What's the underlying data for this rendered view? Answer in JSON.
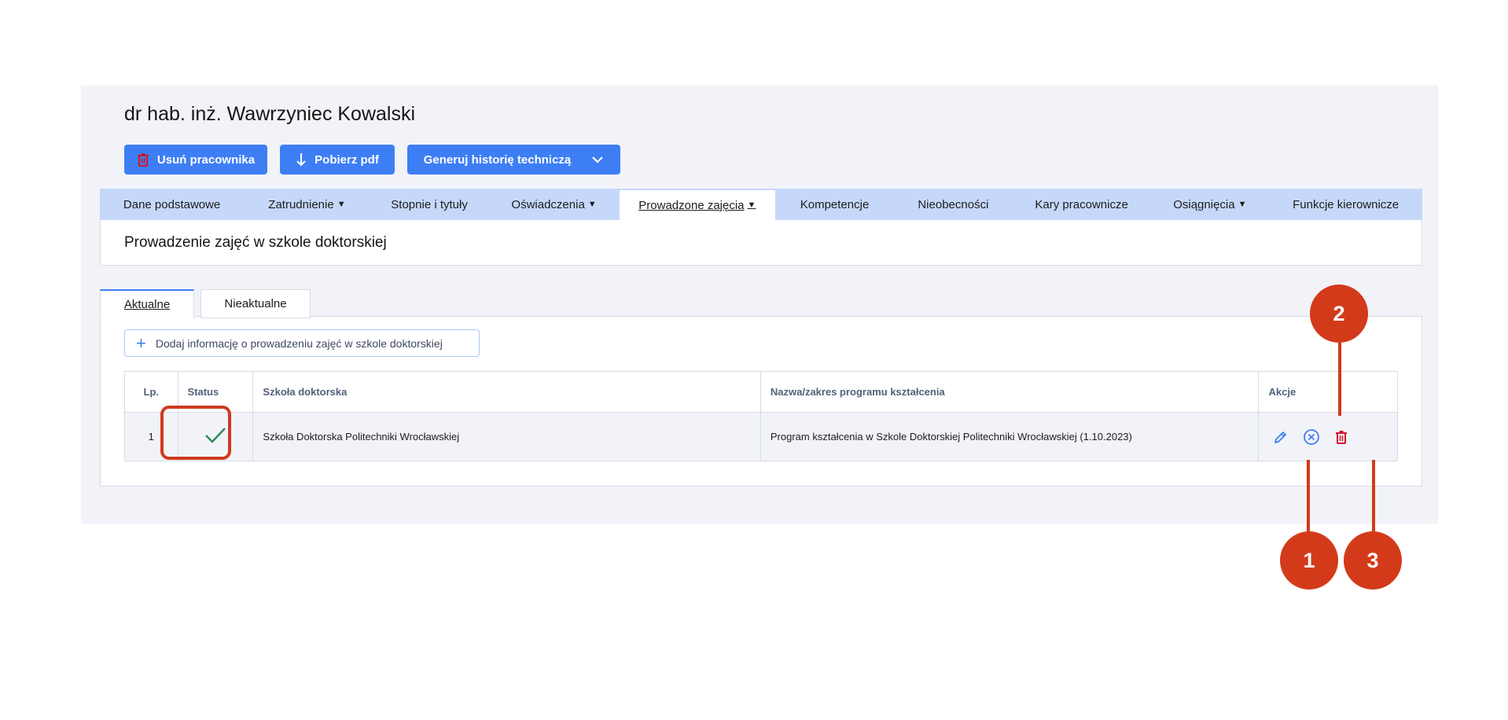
{
  "header": {
    "title": "dr hab. inż. Wawrzyniec Kowalski",
    "buttons": {
      "delete_employee": "Usuń pracownika",
      "download_pdf": "Pobierz pdf",
      "generate_history": "Generuj historię techniczą"
    }
  },
  "nav": {
    "items": [
      {
        "label": "Dane podstawowe",
        "has_dropdown": false
      },
      {
        "label": "Zatrudnienie",
        "has_dropdown": true
      },
      {
        "label": "Stopnie i tytuły",
        "has_dropdown": false
      },
      {
        "label": "Oświadczenia",
        "has_dropdown": true
      },
      {
        "label": "Prowadzone zajęcia",
        "has_dropdown": true,
        "active": true
      },
      {
        "label": "Kompetencje",
        "has_dropdown": false
      },
      {
        "label": "Nieobecności",
        "has_dropdown": false
      },
      {
        "label": "Kary pracownicze",
        "has_dropdown": false
      },
      {
        "label": "Osiągnięcia",
        "has_dropdown": true
      },
      {
        "label": "Funkcje kierownicze",
        "has_dropdown": false
      }
    ]
  },
  "section": {
    "title": "Prowadzenie zajęć w szkole doktorskiej"
  },
  "tabs": {
    "current": "Aktualne",
    "old": "Nieaktualne"
  },
  "add_button": "Dodaj informację o prowadzeniu zajęć w szkole doktorskiej",
  "table": {
    "headers": {
      "lp": "Lp.",
      "status": "Status",
      "school": "Szkoła doktorska",
      "program": "Nazwa/zakres programu kształcenia",
      "actions": "Akcje"
    },
    "rows": [
      {
        "lp": "1",
        "status": "active",
        "school": "Szkoła Doktorska Politechniki Wrocławskiej",
        "program": "Program kształcenia w Szkole Doktorskiej Politechniki Wrocławskiej (1.10.2023)"
      }
    ]
  },
  "callouts": {
    "one": "1",
    "two": "2",
    "three": "3"
  },
  "colors": {
    "accent": "#3d7ef5",
    "nav_bg": "#c6d8fa",
    "callout": "#d33a1a",
    "delete_red": "#d0142b",
    "check_green": "#2e8b57"
  },
  "icons": [
    "trash-icon",
    "download-arrow-icon",
    "chevron-down-icon",
    "plus-icon",
    "checkmark-icon",
    "pencil-icon",
    "cancel-circle-icon",
    "delete-trash-icon"
  ]
}
